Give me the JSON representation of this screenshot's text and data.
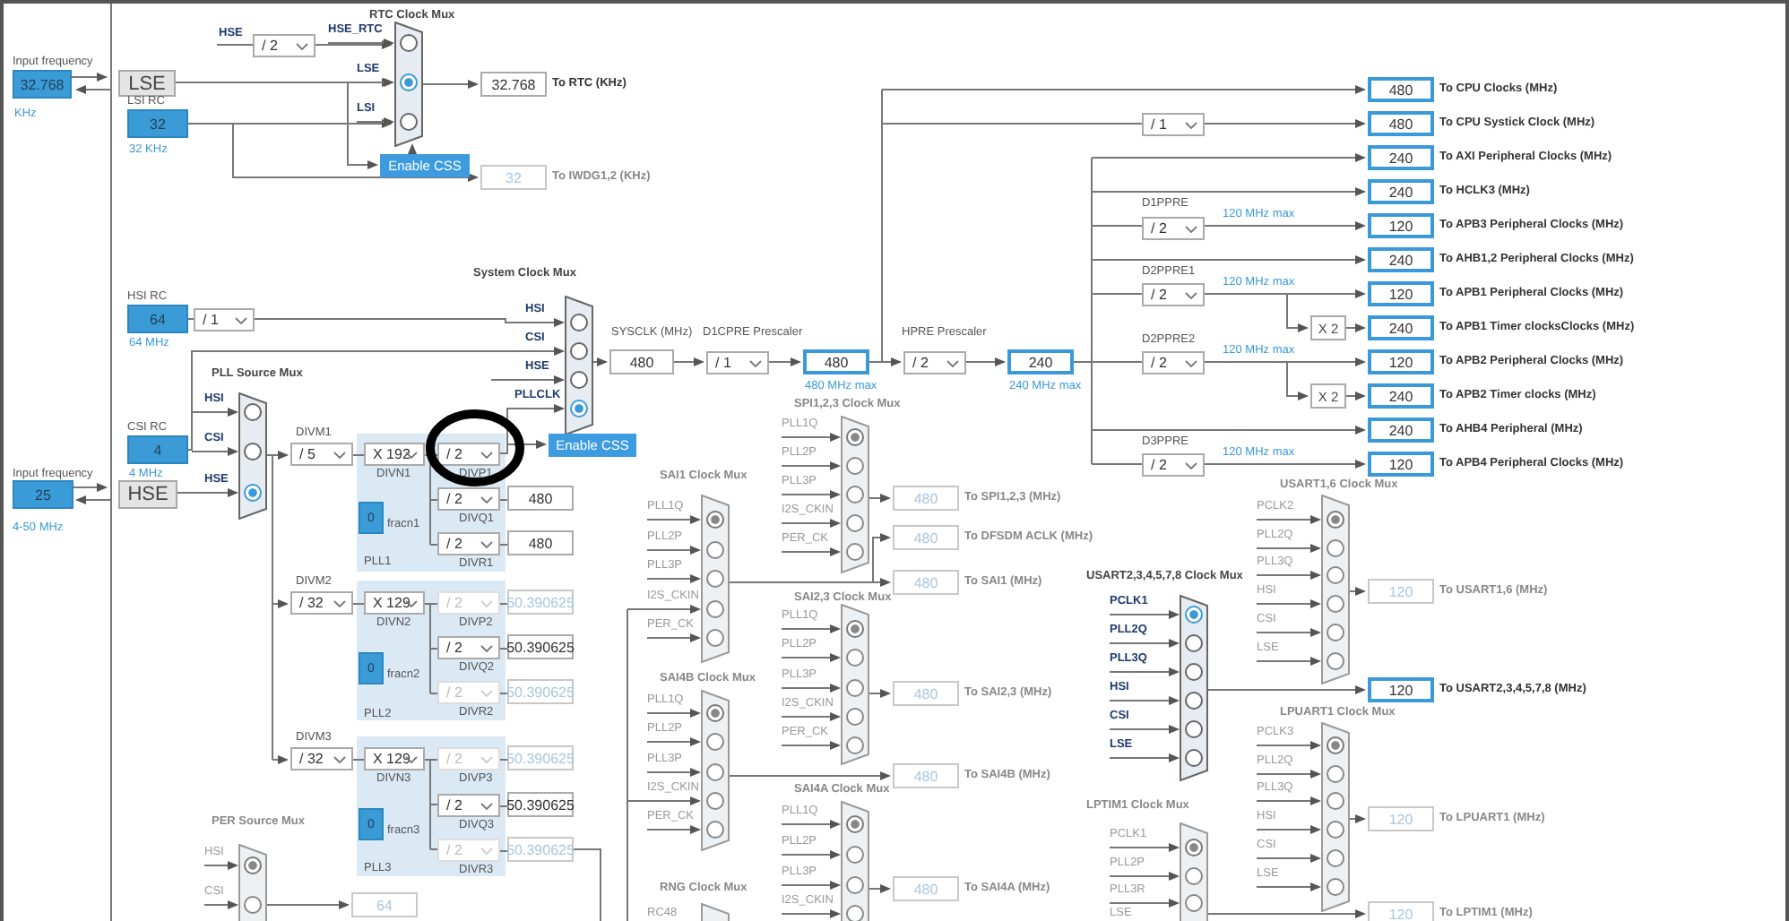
{
  "input_clocks": [
    {
      "label": "Input frequency",
      "value": "32.768",
      "unit": "KHz",
      "source": "LSE"
    },
    {
      "label": "Input frequency",
      "value": "25",
      "unit": "4-50 MHz",
      "source": "HSE"
    }
  ],
  "oscillators": [
    {
      "name": "LSI RC",
      "value": "32",
      "unit": "32 KHz"
    },
    {
      "name": "HSI RC",
      "value": "64",
      "unit": "64 MHz"
    },
    {
      "name": "CSI RC",
      "value": "4",
      "unit": "4 MHz"
    }
  ],
  "wire_labels": [
    {
      "text": "HSE"
    }
  ],
  "muxes": [
    {
      "title": "RTC Clock Mux",
      "disabled": false,
      "inputs": [
        {
          "label": "HSE_RTC",
          "selected": false
        },
        {
          "label": "LSE",
          "selected": true
        },
        {
          "label": "LSI",
          "selected": false
        }
      ]
    },
    {
      "title": "System Clock Mux",
      "disabled": false,
      "inputs": [
        {
          "label": "HSI",
          "selected": false
        },
        {
          "label": "CSI",
          "selected": false
        },
        {
          "label": "HSE",
          "selected": false
        },
        {
          "label": "PLLCLK",
          "selected": true
        }
      ]
    },
    {
      "title": "PLL Source Mux",
      "disabled": false,
      "inputs": [
        {
          "label": "HSI",
          "selected": false
        },
        {
          "label": "CSI",
          "selected": false
        },
        {
          "label": "HSE",
          "selected": true
        }
      ]
    },
    {
      "title": "SPI1,2,3 Clock Mux",
      "disabled": true,
      "inputs": [
        {
          "label": "PLL1Q",
          "selected": true
        },
        {
          "label": "PLL2P",
          "selected": false
        },
        {
          "label": "PLL3P",
          "selected": false
        },
        {
          "label": "I2S_CKIN",
          "selected": false
        },
        {
          "label": "PER_CK",
          "selected": false
        }
      ]
    },
    {
      "title": "SAI1 Clock Mux",
      "disabled": true,
      "inputs": [
        {
          "label": "PLL1Q",
          "selected": true
        },
        {
          "label": "PLL2P",
          "selected": false
        },
        {
          "label": "PLL3P",
          "selected": false
        },
        {
          "label": "I2S_CKIN",
          "selected": false
        },
        {
          "label": "PER_CK",
          "selected": false
        }
      ]
    },
    {
      "title": "SAI2,3 Clock Mux",
      "disabled": true,
      "inputs": [
        {
          "label": "PLL1Q",
          "selected": true
        },
        {
          "label": "PLL2P",
          "selected": false
        },
        {
          "label": "PLL3P",
          "selected": false
        },
        {
          "label": "I2S_CKIN",
          "selected": false
        },
        {
          "label": "PER_CK",
          "selected": false
        }
      ]
    },
    {
      "title": "SAI4B Clock Mux",
      "disabled": true,
      "inputs": [
        {
          "label": "PLL1Q",
          "selected": true
        },
        {
          "label": "PLL2P",
          "selected": false
        },
        {
          "label": "PLL3P",
          "selected": false
        },
        {
          "label": "I2S_CKIN",
          "selected": false
        },
        {
          "label": "PER_CK",
          "selected": false
        }
      ]
    },
    {
      "title": "SAI4A Clock Mux",
      "disabled": true,
      "inputs": [
        {
          "label": "PLL1Q",
          "selected": true
        },
        {
          "label": "PLL2P",
          "selected": false
        },
        {
          "label": "PLL3P",
          "selected": false
        },
        {
          "label": "I2S_CKIN",
          "selected": false
        }
      ]
    },
    {
      "title": "RNG Clock Mux",
      "disabled": true,
      "inputs": [
        {
          "label": "RC48"
        }
      ]
    },
    {
      "title": "PER Source Mux",
      "disabled": true,
      "inputs": [
        {
          "label": "HSI",
          "selected": true
        },
        {
          "label": "CSI",
          "selected": false
        }
      ]
    },
    {
      "title": "USART2,3,4,5,7,8 Clock Mux",
      "disabled": false,
      "inputs": [
        {
          "label": "PCLK1",
          "selected": true
        },
        {
          "label": "PLL2Q",
          "selected": false
        },
        {
          "label": "PLL3Q",
          "selected": false
        },
        {
          "label": "HSI",
          "selected": false
        },
        {
          "label": "CSI",
          "selected": false
        },
        {
          "label": "LSE",
          "selected": false
        }
      ]
    },
    {
      "title": "USART1,6 Clock Mux",
      "disabled": true,
      "inputs": [
        {
          "label": "PCLK2",
          "selected": true
        },
        {
          "label": "PLL2Q",
          "selected": false
        },
        {
          "label": "PLL3Q",
          "selected": false
        },
        {
          "label": "HSI",
          "selected": false
        },
        {
          "label": "CSI",
          "selected": false
        },
        {
          "label": "LSE",
          "selected": false
        }
      ]
    },
    {
      "title": "LPUART1 Clock Mux",
      "disabled": true,
      "inputs": [
        {
          "label": "PCLK3",
          "selected": true
        },
        {
          "label": "PLL2Q",
          "selected": false
        },
        {
          "label": "PLL3Q",
          "selected": false
        },
        {
          "label": "HSI",
          "selected": false
        },
        {
          "label": "CSI",
          "selected": false
        },
        {
          "label": "LSE",
          "selected": false
        }
      ]
    },
    {
      "title": "LPTIM1 Clock Mux",
      "disabled": true,
      "inputs": [
        {
          "label": "PCLK1",
          "selected": true
        },
        {
          "label": "PLL2P",
          "selected": false
        },
        {
          "label": "PLL3R",
          "selected": false
        },
        {
          "label": "LSE"
        }
      ]
    }
  ],
  "prescalers": [
    {
      "value": "/ 2",
      "disabled": false
    },
    {
      "value": "/ 1",
      "disabled": false
    },
    {
      "label": "DIVM1",
      "value": "/ 5",
      "disabled": false
    },
    {
      "label": "DIVN1",
      "value": "X 192",
      "disabled": false
    },
    {
      "label": "DIVP1",
      "value": "/ 2",
      "disabled": false
    },
    {
      "label": "DIVQ1",
      "value": "/ 2",
      "disabled": false
    },
    {
      "label": "DIVR1",
      "value": "/ 2",
      "disabled": false
    },
    {
      "label": "DIVM2",
      "value": "/ 32",
      "disabled": false
    },
    {
      "label": "DIVN2",
      "value": "X 129",
      "disabled": false
    },
    {
      "label": "DIVP2",
      "value": "/ 2",
      "disabled": true
    },
    {
      "label": "DIVQ2",
      "value": "/ 2",
      "disabled": false
    },
    {
      "label": "DIVR2",
      "value": "/ 2",
      "disabled": true
    },
    {
      "label": "DIVM3",
      "value": "/ 32",
      "disabled": false
    },
    {
      "label": "DIVN3",
      "value": "X 129",
      "disabled": false
    },
    {
      "label": "DIVP3",
      "value": "/ 2",
      "disabled": true
    },
    {
      "label": "DIVQ3",
      "value": "/ 2",
      "disabled": false
    },
    {
      "label": "DIVR3",
      "value": "/ 2",
      "disabled": true
    },
    {
      "label": "D1CPRE Prescaler",
      "value": "/ 1",
      "disabled": false
    },
    {
      "label": "HPRE Prescaler",
      "value": "/ 2",
      "disabled": false
    },
    {
      "value": "/ 1",
      "disabled": false
    },
    {
      "label": "D1PPRE",
      "value": "/ 2",
      "disabled": false
    },
    {
      "label": "D2PPRE1",
      "value": "/ 2",
      "disabled": false
    },
    {
      "label": "D2PPRE2",
      "value": "/ 2",
      "disabled": false
    },
    {
      "label": "D3PPRE",
      "value": "/ 2",
      "disabled": false
    }
  ],
  "plls": [
    {
      "name": "PLL1",
      "fracn_label": "fracn1",
      "fracn": "0"
    },
    {
      "name": "PLL2",
      "fracn_label": "fracn2",
      "fracn": "0"
    },
    {
      "name": "PLL3",
      "fracn_label": "fracn3",
      "fracn": "0"
    }
  ],
  "value_boxes": [
    {
      "value": "32.768",
      "label": "To RTC (KHz)",
      "highlighted": false,
      "disabled": false
    },
    {
      "value": "32",
      "label": "To IWDG1,2 (KHz)",
      "highlighted": false,
      "disabled": true
    },
    {
      "value": "480",
      "label": "To CPU Clocks (MHz)",
      "highlighted": true,
      "disabled": false
    },
    {
      "value": "480",
      "label": "To CPU Systick Clock (MHz)",
      "highlighted": true,
      "disabled": false
    },
    {
      "value": "240",
      "label": "To AXI Peripheral Clocks (MHz)",
      "highlighted": true,
      "disabled": false
    },
    {
      "value": "240",
      "label": "To HCLK3 (MHz)",
      "highlighted": true,
      "disabled": false
    },
    {
      "value": "120",
      "label": "To APB3 Peripheral Clocks (MHz)",
      "highlighted": true,
      "disabled": false
    },
    {
      "value": "240",
      "label": "To AHB1,2 Peripheral Clocks (MHz)",
      "highlighted": true,
      "disabled": false
    },
    {
      "value": "120",
      "label": "To APB1 Peripheral Clocks (MHz)",
      "highlighted": true,
      "disabled": false
    },
    {
      "value": "240",
      "label": "To APB1 Timer clocksClocks (MHz)",
      "highlighted": true,
      "disabled": false
    },
    {
      "value": "120",
      "label": "To APB2 Peripheral Clocks (MHz)",
      "highlighted": true,
      "disabled": false
    },
    {
      "value": "240",
      "label": "To APB2 Timer clocks (MHz)",
      "highlighted": true,
      "disabled": false
    },
    {
      "value": "240",
      "label": "To AHB4 Peripheral (MHz)",
      "highlighted": true,
      "disabled": false
    },
    {
      "value": "120",
      "label": "To APB4 Peripheral Clocks (MHz)",
      "highlighted": true,
      "disabled": false
    },
    {
      "value": "480",
      "label": "To SPI1,2,3 (MHz)",
      "highlighted": false,
      "disabled": true
    },
    {
      "value": "480",
      "label": "To DFSDM ACLK (MHz)",
      "highlighted": false,
      "disabled": true
    },
    {
      "value": "480",
      "label": "To SAI1 (MHz)",
      "highlighted": false,
      "disabled": true
    },
    {
      "value": "480",
      "label": "To SAI2,3 (MHz)",
      "highlighted": false,
      "disabled": true
    },
    {
      "value": "480",
      "label": "To SAI4B (MHz)",
      "highlighted": false,
      "disabled": true
    },
    {
      "value": "480",
      "label": "To SAI4A (MHz)",
      "highlighted": false,
      "disabled": true
    },
    {
      "value": "120",
      "label": "To USART1,6 (MHz)",
      "highlighted": false,
      "disabled": true
    },
    {
      "value": "120",
      "label": "To USART2,3,4,5,7,8 (MHz)",
      "highlighted": true,
      "disabled": false
    },
    {
      "value": "120",
      "label": "To LPUART1 (MHz)",
      "highlighted": false,
      "disabled": true
    },
    {
      "value": "120",
      "label": "To LPTIM1 (MHz)",
      "highlighted": false,
      "disabled": true
    },
    {
      "value": "480",
      "highlighted": false,
      "disabled": false
    },
    {
      "value": "480",
      "highlighted": false,
      "disabled": false
    },
    {
      "value": "50.390625",
      "highlighted": false,
      "disabled": true
    },
    {
      "value": "50.390625",
      "highlighted": false,
      "disabled": false
    },
    {
      "value": "50.390625",
      "highlighted": false,
      "disabled": true
    },
    {
      "value": "50.390625",
      "highlighted": false,
      "disabled": true
    },
    {
      "value": "50.390625",
      "highlighted": false,
      "disabled": false
    },
    {
      "value": "50.390625",
      "highlighted": false,
      "disabled": true
    },
    {
      "value": "480",
      "highlighted": false,
      "disabled": false
    },
    {
      "value": "480",
      "highlighted": true,
      "disabled": false
    },
    {
      "value": "240",
      "highlighted": true,
      "disabled": false
    },
    {
      "value": "64",
      "highlighted": false,
      "disabled": true
    }
  ],
  "notes": [
    {
      "kind": "caption",
      "text": "SYSCLK (MHz)"
    },
    {
      "kind": "limit",
      "text": "480 MHz max"
    },
    {
      "kind": "limit",
      "text": "240 MHz max"
    },
    {
      "kind": "limit",
      "text": "120 MHz max"
    },
    {
      "kind": "limit",
      "text": "120 MHz max"
    },
    {
      "kind": "limit",
      "text": "120 MHz max"
    },
    {
      "kind": "limit",
      "text": "120 MHz max"
    }
  ],
  "buttons": [
    {
      "label": "Enable CSS"
    },
    {
      "label": "Enable CSS"
    }
  ],
  "multipliers": [
    {
      "value": "X 2"
    },
    {
      "value": "X 2"
    }
  ],
  "markup": [
    {
      "kind": "ellipse"
    }
  ]
}
